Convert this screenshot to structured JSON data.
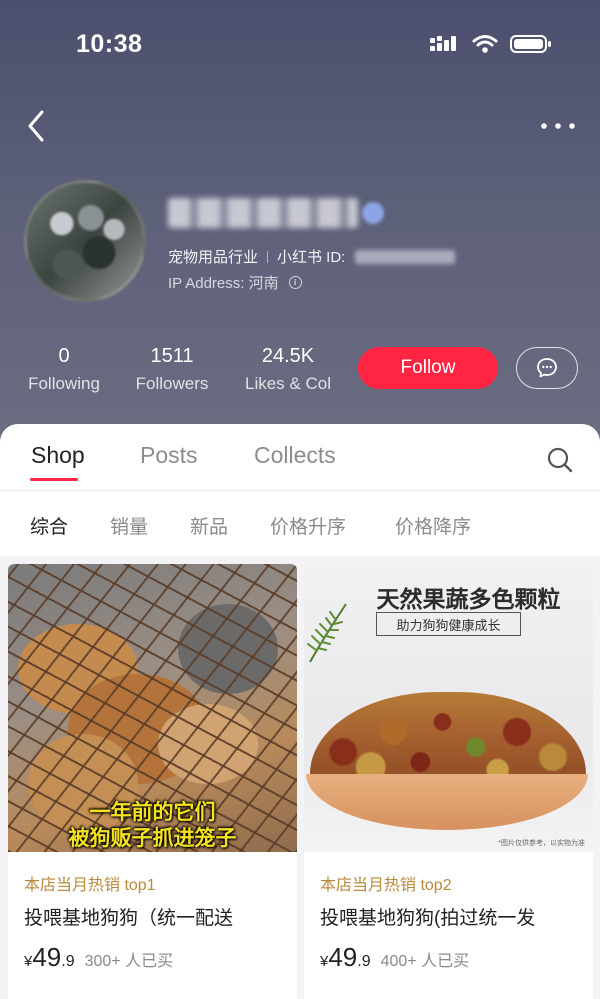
{
  "status_bar": {
    "time": "10:38"
  },
  "profile": {
    "industry": "宠物用品行业",
    "id_label": "小红书 ID:",
    "ip_address": "IP Address: 河南"
  },
  "stats": [
    {
      "value": "0",
      "label": "Following"
    },
    {
      "value": "1511",
      "label": "Followers"
    },
    {
      "value": "24.5K",
      "label": "Likes & Col"
    }
  ],
  "actions": {
    "follow_label": "Follow"
  },
  "tabs": [
    {
      "label": "Shop",
      "active": true
    },
    {
      "label": "Posts",
      "active": false
    },
    {
      "label": "Collects",
      "active": false
    }
  ],
  "filters": [
    {
      "label": "综合",
      "active": true
    },
    {
      "label": "销量",
      "active": false
    },
    {
      "label": "新品",
      "active": false
    },
    {
      "label": "价格升序",
      "active": false
    },
    {
      "label": "价格降序",
      "active": false
    }
  ],
  "products": [
    {
      "image_text_line1": "一年前的它们",
      "image_text_line2": "被狗贩子抓进笼子",
      "tag": "本店当月热销 top1",
      "title": "投喂基地狗狗（统一配送",
      "price_symbol": "¥",
      "price_int": "49",
      "price_dec": ".9",
      "sold": "300+ 人已买"
    },
    {
      "image_title": "天然果蔬多色颗粒",
      "image_subtitle": "助力狗狗健康成长",
      "image_note": "*图片仅供参考，以实物为准",
      "tag": "本店当月热销 top2",
      "title": "投喂基地狗狗(拍过统一发",
      "price_symbol": "¥",
      "price_int": "49",
      "price_dec": ".9",
      "sold": "400+ 人已买"
    }
  ],
  "colors": {
    "accent": "#ff2442",
    "tag_gold": "#b88a3c"
  }
}
